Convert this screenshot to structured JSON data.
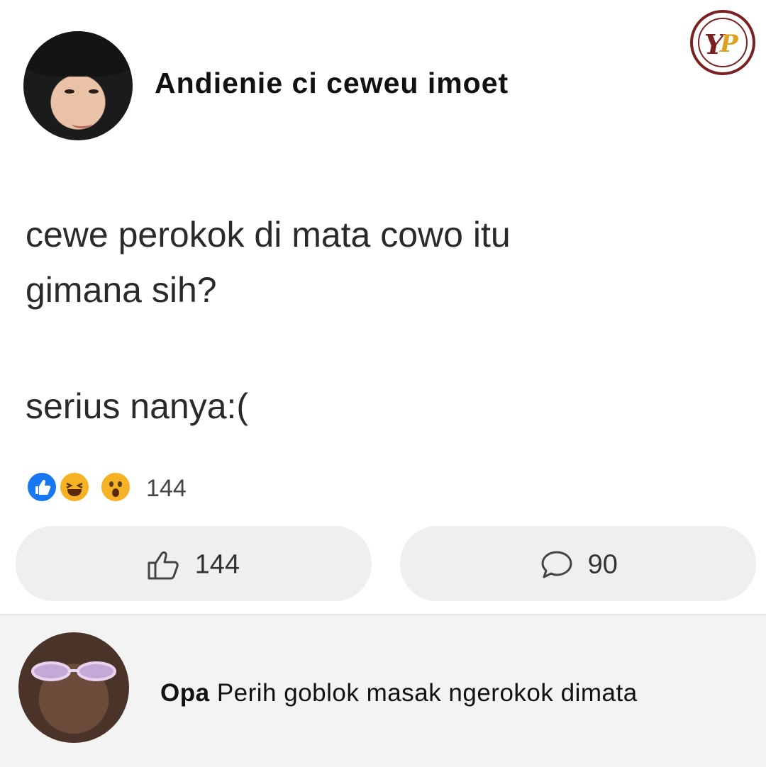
{
  "post": {
    "author": "Andienie ci ceweu imoet",
    "text_line1": "cewe perokok di mata cowo itu",
    "text_line2": "gimana sih?",
    "text_line3": "serius nanya:(",
    "reaction_icons": [
      "like-icon",
      "haha-icon",
      "wow-icon"
    ],
    "reaction_count": "144",
    "like_count": "144",
    "comment_count": "90"
  },
  "comment": {
    "author": "Opa",
    "text": "Perih goblok masak ngerokok dimata"
  },
  "colors": {
    "like_blue": "#1877f2",
    "emoji_yellow": "#f7b125",
    "logo_red": "#7a2020",
    "button_bg": "#efefef"
  }
}
